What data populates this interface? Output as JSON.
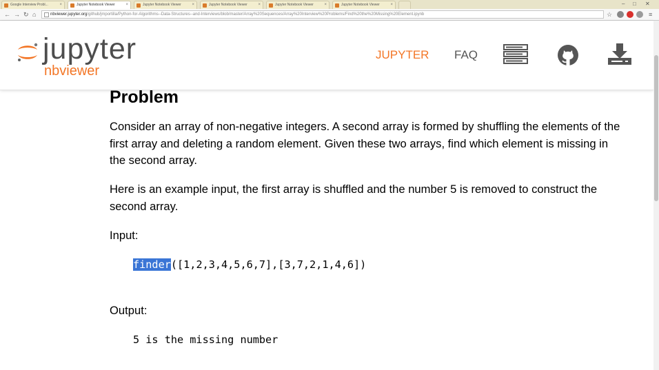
{
  "browser": {
    "tabs": [
      {
        "label": "Google Interview Probl..."
      },
      {
        "label": "Jupyter Notebook Viewer"
      },
      {
        "label": "Jupyter Notebook Viewer"
      },
      {
        "label": "Jupyter Notebook Viewer"
      },
      {
        "label": "Jupyter Notebook Viewer"
      },
      {
        "label": "Jupyter Notebook Viewer"
      }
    ],
    "address": {
      "host": "nbviewer.jupyter.org",
      "path": "/github/jmportilla/Python-for-Algorithms--Data-Structures--and-Interviews/blob/master/Array%20Sequences/Array%20Interview%20Problems/Find%20the%20Missing%20Element.ipynb"
    }
  },
  "header": {
    "logo_word": "jupyter",
    "logo_sub": "nbviewer",
    "nav": {
      "jupyter": "JUPYTER",
      "faq": "FAQ"
    },
    "icons": [
      "list-view-icon",
      "github-icon",
      "download-icon"
    ],
    "colors": {
      "accent": "#f37626",
      "text": "#4d4d4d"
    }
  },
  "notebook": {
    "heading": "Problem",
    "para1": "Consider an array of non-negative integers. A second array is formed by shuffling the elements of the first array and deleting a random element. Given these two arrays, find which element is missing in the second array.",
    "para2": "Here is an example input, the first array is shuffled and the number 5 is removed to construct the second array.",
    "input_label": "Input:",
    "code_call_selected": "finder",
    "code_call_rest": "([1,2,3,4,5,6,7],[3,7,2,1,4,6])",
    "output_label": "Output:",
    "output_text": "5 is the missing number"
  }
}
